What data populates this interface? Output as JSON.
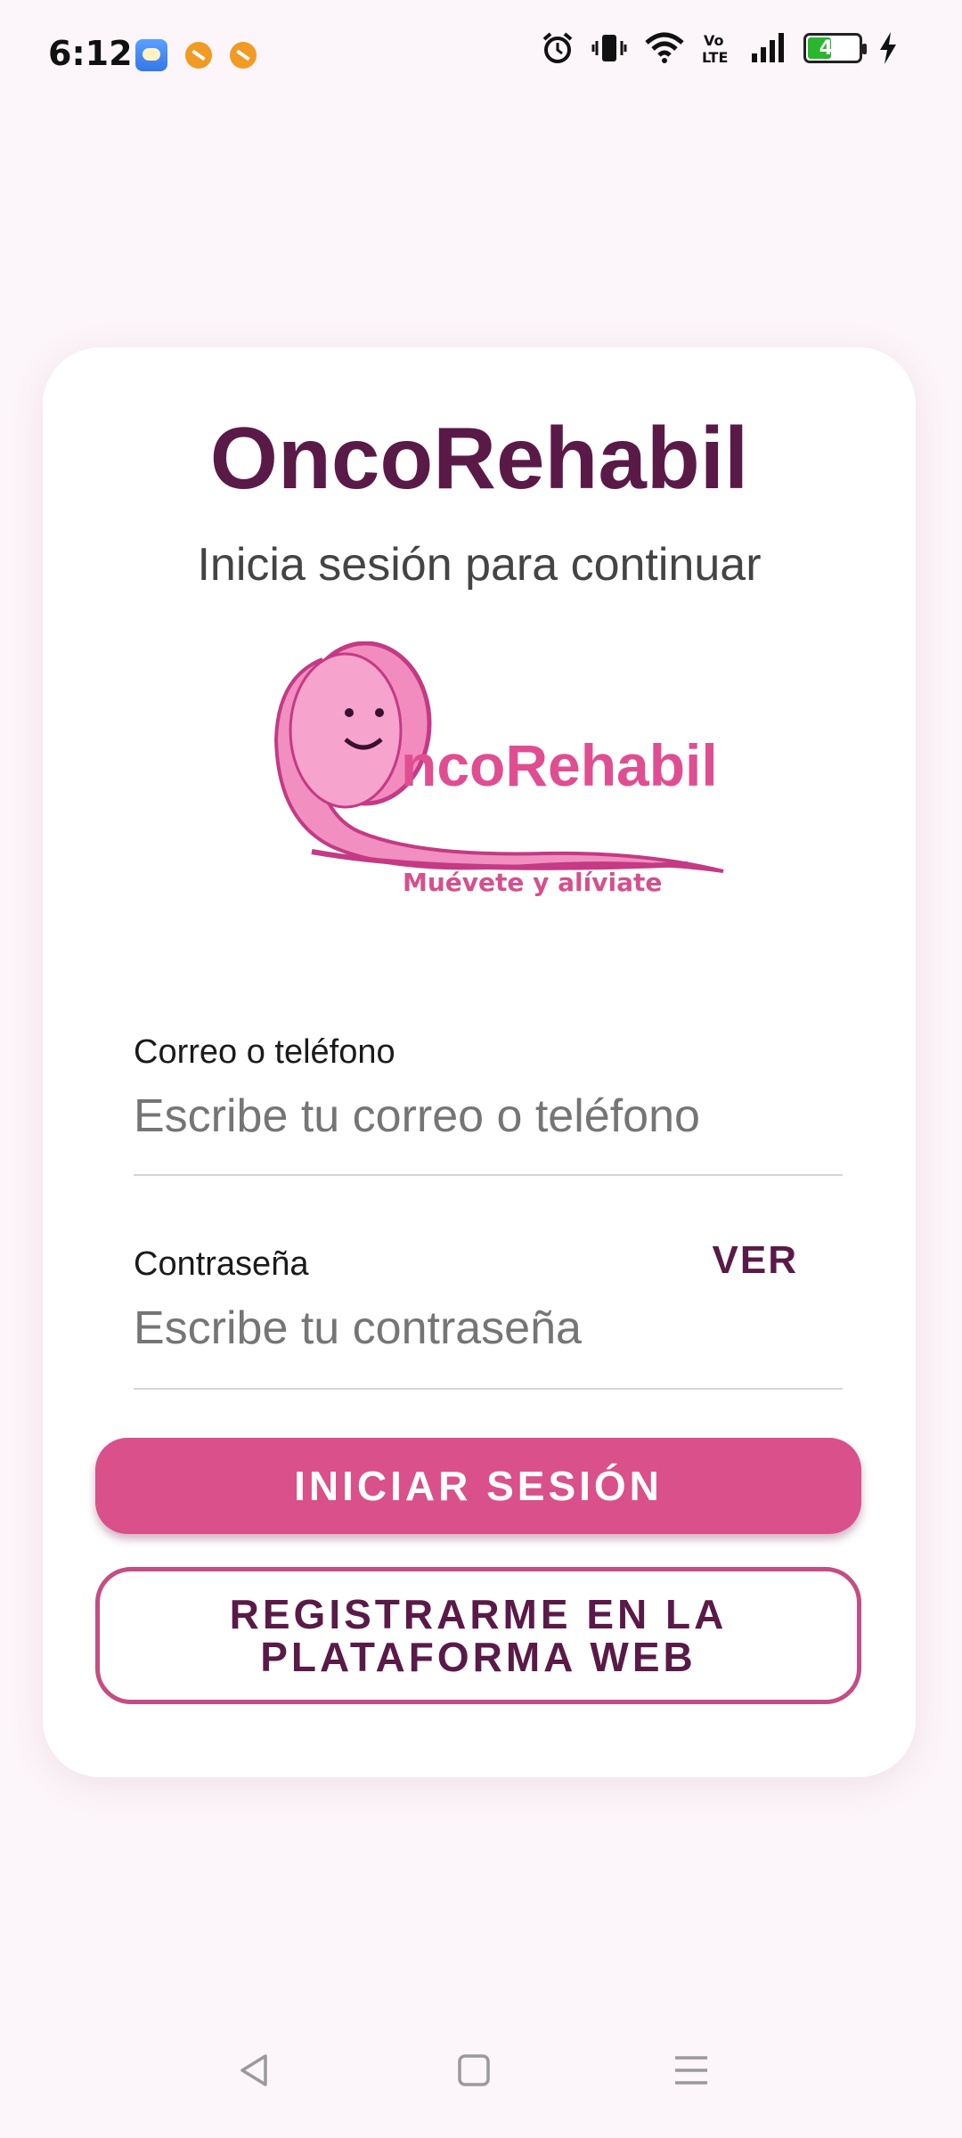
{
  "status_bar": {
    "time": "6:12",
    "battery_level": "42",
    "icons": [
      "weather-app-icon",
      "app-notification-icon",
      "app-notification-icon",
      "alarm-icon",
      "vibrate-icon",
      "wifi-icon",
      "volte-icon",
      "signal-icon",
      "battery-icon",
      "charging-icon"
    ]
  },
  "login": {
    "app_title": "OncoRehabil",
    "subtitle": "Inicia sesión para continuar",
    "logo": {
      "brand_text": "ncoRehabil",
      "tagline": "Muévete y alíviate"
    },
    "email_field": {
      "label": "Correo o teléfono",
      "placeholder": "Escribe tu correo o teléfono",
      "value": ""
    },
    "password_field": {
      "label": "Contraseña",
      "placeholder": "Escribe tu contraseña",
      "value": "",
      "show_label": "VER"
    },
    "login_button": "INICIAR SESIÓN",
    "register_button": "REGISTRARME EN LA PLATAFORMA WEB"
  },
  "colors": {
    "background": "#fcf5f9",
    "title": "#5a1a48",
    "primary_button": "#d9508a",
    "secondary_border": "#c44d83",
    "logo_pink": "#e96aa8"
  },
  "nav_bar": {
    "buttons": [
      "back-icon",
      "home-icon",
      "menu-icon"
    ]
  }
}
